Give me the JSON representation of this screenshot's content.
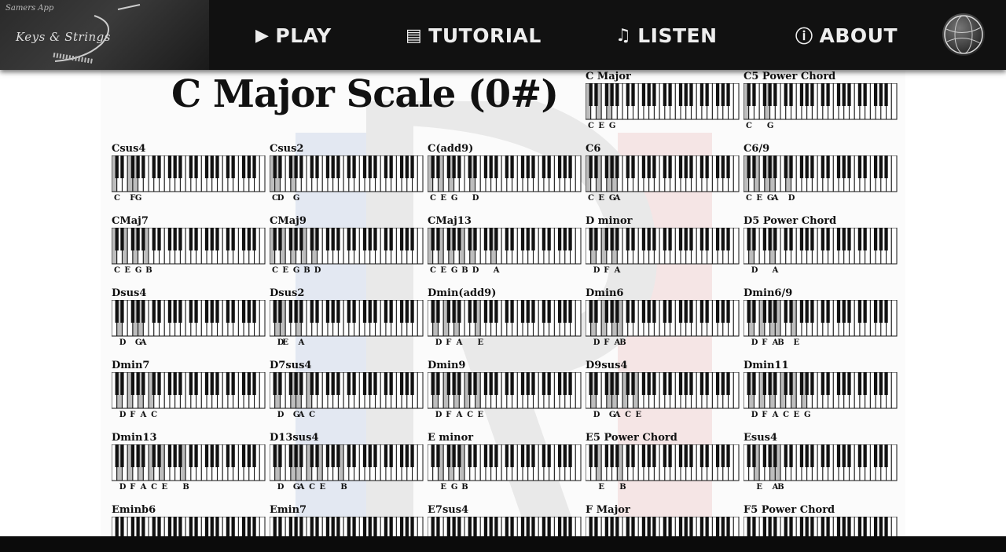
{
  "header": {
    "logo_small": "Samers App",
    "logo_name": "Keys & Strings",
    "nav": [
      {
        "label": "PLAY",
        "icon": "play-icon"
      },
      {
        "label": "TUTORIAL",
        "icon": "book-icon"
      },
      {
        "label": "LISTEN",
        "icon": "music-note-icon"
      },
      {
        "label": "ABOUT",
        "icon": "info-icon"
      }
    ],
    "profile_icon": "globe-icon"
  },
  "page": {
    "title": "C Major Scale (0#)"
  },
  "chords": [
    {
      "name": "C Major",
      "notes": [
        "C",
        "E",
        "G"
      ]
    },
    {
      "name": "C5 Power Chord",
      "notes": [
        "C",
        "G"
      ]
    },
    {
      "name": "Csus4",
      "notes": [
        "C",
        "F",
        "G"
      ]
    },
    {
      "name": "Csus2",
      "notes": [
        "C",
        "D",
        "G"
      ]
    },
    {
      "name": "C(add9)",
      "notes": [
        "C",
        "E",
        "G",
        "D"
      ]
    },
    {
      "name": "C6",
      "notes": [
        "C",
        "E",
        "G",
        "A"
      ]
    },
    {
      "name": "C6/9",
      "notes": [
        "C",
        "E",
        "G",
        "A",
        "D"
      ]
    },
    {
      "name": "CMaj7",
      "notes": [
        "C",
        "E",
        "G",
        "B"
      ]
    },
    {
      "name": "CMaj9",
      "notes": [
        "C",
        "E",
        "G",
        "B",
        "D"
      ]
    },
    {
      "name": "CMaj13",
      "notes": [
        "C",
        "E",
        "G",
        "B",
        "D",
        "A"
      ]
    },
    {
      "name": "D minor",
      "notes": [
        "D",
        "F",
        "A"
      ]
    },
    {
      "name": "D5 Power Chord",
      "notes": [
        "D",
        "A"
      ]
    },
    {
      "name": "Dsus4",
      "notes": [
        "D",
        "G",
        "A"
      ]
    },
    {
      "name": "Dsus2",
      "notes": [
        "D",
        "E",
        "A"
      ]
    },
    {
      "name": "Dmin(add9)",
      "notes": [
        "D",
        "F",
        "A",
        "E"
      ]
    },
    {
      "name": "Dmin6",
      "notes": [
        "D",
        "F",
        "A",
        "B"
      ]
    },
    {
      "name": "Dmin6/9",
      "notes": [
        "D",
        "F",
        "A",
        "B",
        "E"
      ]
    },
    {
      "name": "Dmin7",
      "notes": [
        "D",
        "F",
        "A",
        "C"
      ]
    },
    {
      "name": "D7sus4",
      "notes": [
        "D",
        "G",
        "A",
        "C"
      ]
    },
    {
      "name": "Dmin9",
      "notes": [
        "D",
        "F",
        "A",
        "C",
        "E"
      ]
    },
    {
      "name": "D9sus4",
      "notes": [
        "D",
        "G",
        "A",
        "C",
        "E"
      ]
    },
    {
      "name": "Dmin11",
      "notes": [
        "D",
        "F",
        "A",
        "C",
        "E",
        "G"
      ]
    },
    {
      "name": "Dmin13",
      "notes": [
        "D",
        "F",
        "A",
        "C",
        "E",
        "B"
      ]
    },
    {
      "name": "D13sus4",
      "notes": [
        "D",
        "G",
        "A",
        "C",
        "E",
        "B"
      ]
    },
    {
      "name": "E minor",
      "notes": [
        "E",
        "G",
        "B"
      ]
    },
    {
      "name": "E5 Power Chord",
      "notes": [
        "E",
        "B"
      ]
    },
    {
      "name": "Esus4",
      "notes": [
        "E",
        "A",
        "B"
      ]
    },
    {
      "name": "Eminb6",
      "notes": []
    },
    {
      "name": "Emin7",
      "notes": []
    },
    {
      "name": "E7sus4",
      "notes": []
    },
    {
      "name": "F Major",
      "notes": []
    },
    {
      "name": "F5 Power Chord",
      "notes": []
    }
  ]
}
